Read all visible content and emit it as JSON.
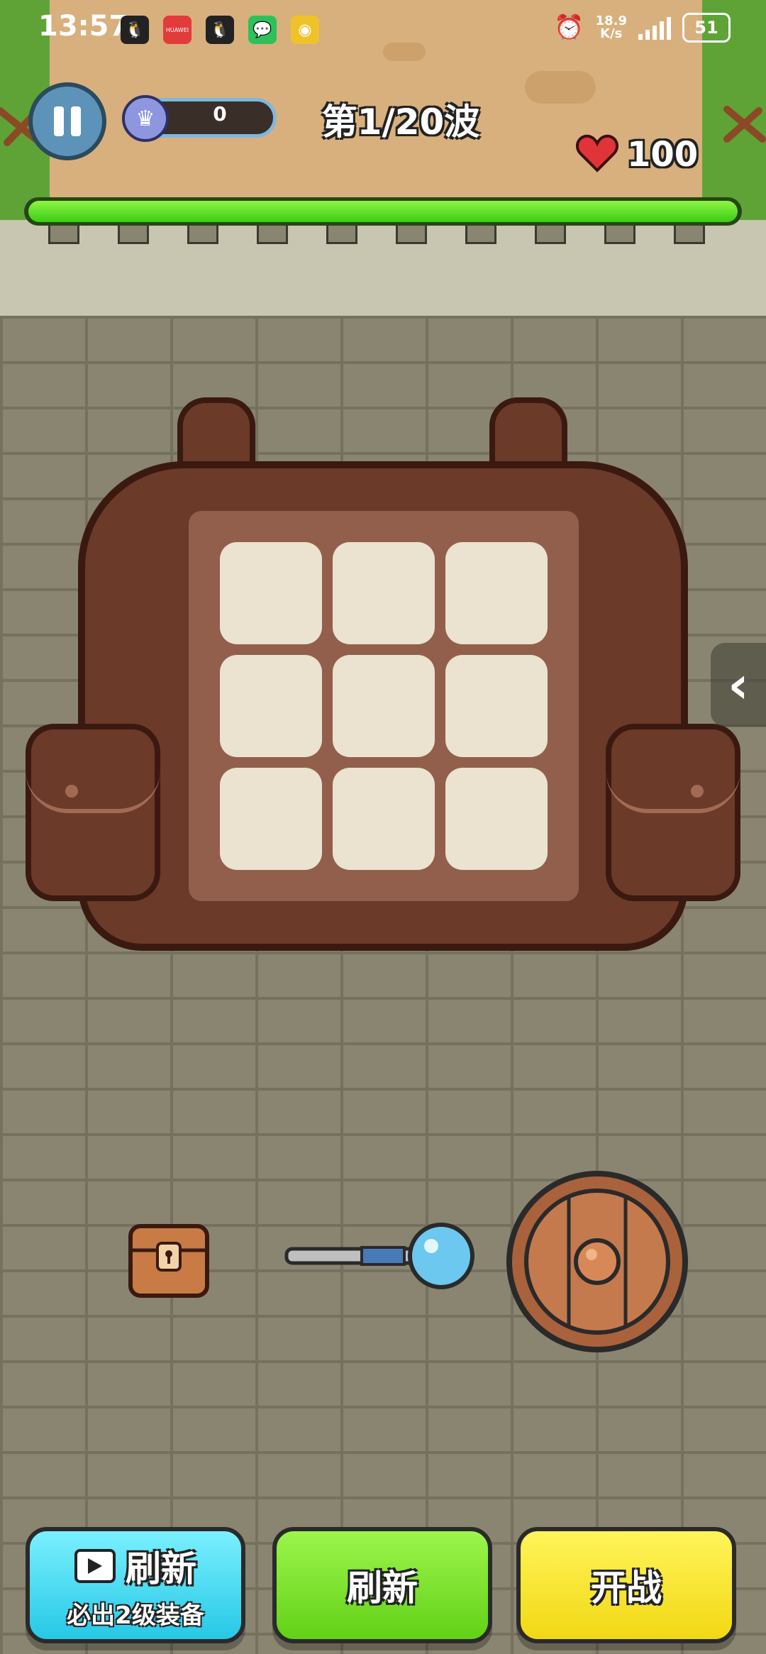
{
  "status_bar": {
    "time": "13:57",
    "net_speed_value": "18.9",
    "net_speed_unit": "K/s",
    "battery": "51",
    "app_icons": [
      "qq-icon",
      "huawei-store-icon",
      "qq-icon",
      "wechat-icon",
      "weibo-icon"
    ],
    "huawei_label": "HUAWEI"
  },
  "hud": {
    "gem_count": "0",
    "wave": "第1/20波",
    "health": "100",
    "wave_progress": 1.0
  },
  "backpack": {
    "slots": 9,
    "rows": 3,
    "cols": 3
  },
  "items": [
    "treasure-chest",
    "magic-staff",
    "wooden-shield"
  ],
  "buttons": {
    "ad_refresh_label": "刷新",
    "ad_refresh_sub": "必出2级装备",
    "refresh_label": "刷新",
    "start_label": "开战"
  },
  "colors": {
    "health_bar": "#3bcc12",
    "ad_button": "#26c8e6",
    "refresh_button": "#62d117",
    "start_button": "#f2d814",
    "heart": "#e0343a"
  }
}
